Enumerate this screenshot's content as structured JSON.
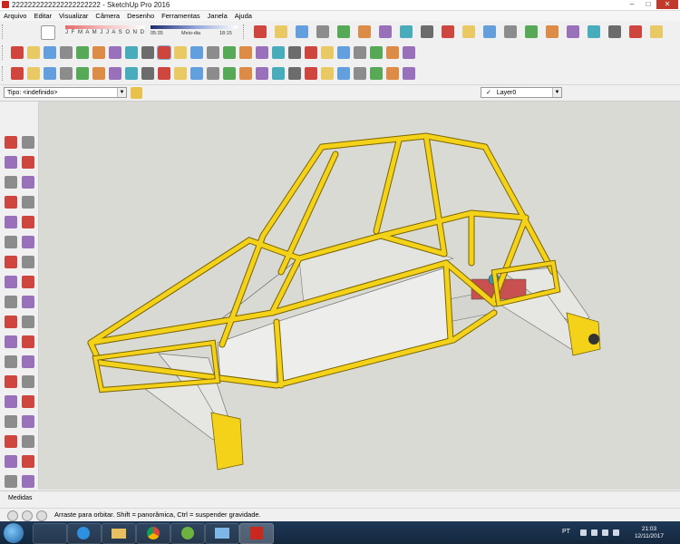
{
  "window": {
    "title": "2222222222222222222222 - SketchUp Pro 2016"
  },
  "menu": [
    "Arquivo",
    "Editar",
    "Visualizar",
    "Câmera",
    "Desenho",
    "Ferramentas",
    "Janela",
    "Ajuda"
  ],
  "shadows": {
    "months": "J F M A M J J A S O N D",
    "time_start": "05:35",
    "time_mid": "Meio-dia",
    "time_end": "18:15"
  },
  "entity_info": {
    "type_label": "Tipo:",
    "type_value": "<indefinido>"
  },
  "layer": {
    "current": "Layer0"
  },
  "measurements": {
    "label": "Medidas"
  },
  "status": {
    "hint": "Arraste para orbitar. Shift = panorâmica, Ctrl = suspender gravidade."
  },
  "taskbar": {
    "language": "PT",
    "time": "21:03",
    "date": "12/11/2017"
  },
  "colors": {
    "frame": "#f5d21a",
    "frame_edge": "#7a6400",
    "panel": "#ededeb",
    "sky": "#d9dad4",
    "suspension": "#e6e6e2"
  },
  "icons": {
    "toolbar1": [
      "paint-bucket-icon",
      "eraser-icon",
      "components-icon",
      "camera-icon",
      "house-icon",
      "home-view-icon",
      "search-icon",
      "model-info-icon",
      "photo-icon",
      "plugin-icon",
      "soften-icon",
      "section-icon",
      "x-ray-icon",
      "shaded-icon",
      "camera-cube-icon",
      "warehouse-icon",
      "share-icon",
      "layers-icon",
      "scenes-icon",
      "measure-icon",
      "protractor-icon",
      "text-icon",
      "axes-icon",
      "dimension-icon",
      "paint-icon"
    ],
    "toolbar2": [
      "move-icon",
      "scissors-icon",
      "copy-icon",
      "paste-icon",
      "delete-icon",
      "undo-icon",
      "redo-icon",
      "print-icon",
      "follow-me-icon",
      "arrow-select-icon",
      "pushpull-icon",
      "rotate-icon",
      "scale-icon",
      "offset-icon",
      "tape-icon",
      "flip-icon",
      "look-around-icon",
      "walk-icon",
      "orbit-icon",
      "pan-icon",
      "zoom-icon",
      "zoom-window-icon",
      "zoom-extents-icon",
      "previous-view-icon",
      "next-view-icon"
    ],
    "toolbar3": [
      "line-icon",
      "freehand-icon",
      "rectangle-icon",
      "rotated-rect-icon",
      "circle-icon",
      "polygon-icon",
      "arc-icon",
      "two-point-arc-icon",
      "pie-icon",
      "arc3-icon",
      "iso-view-icon",
      "top-view-icon",
      "front-view-icon",
      "right-view-icon",
      "back-view-icon",
      "left-view-icon",
      "select-icon",
      "eraser-icon",
      "pencil-icon",
      "arc-tool-icon",
      "pushpull-icon",
      "move-icon",
      "offset-icon",
      "tape-icon",
      "text-icon"
    ]
  }
}
